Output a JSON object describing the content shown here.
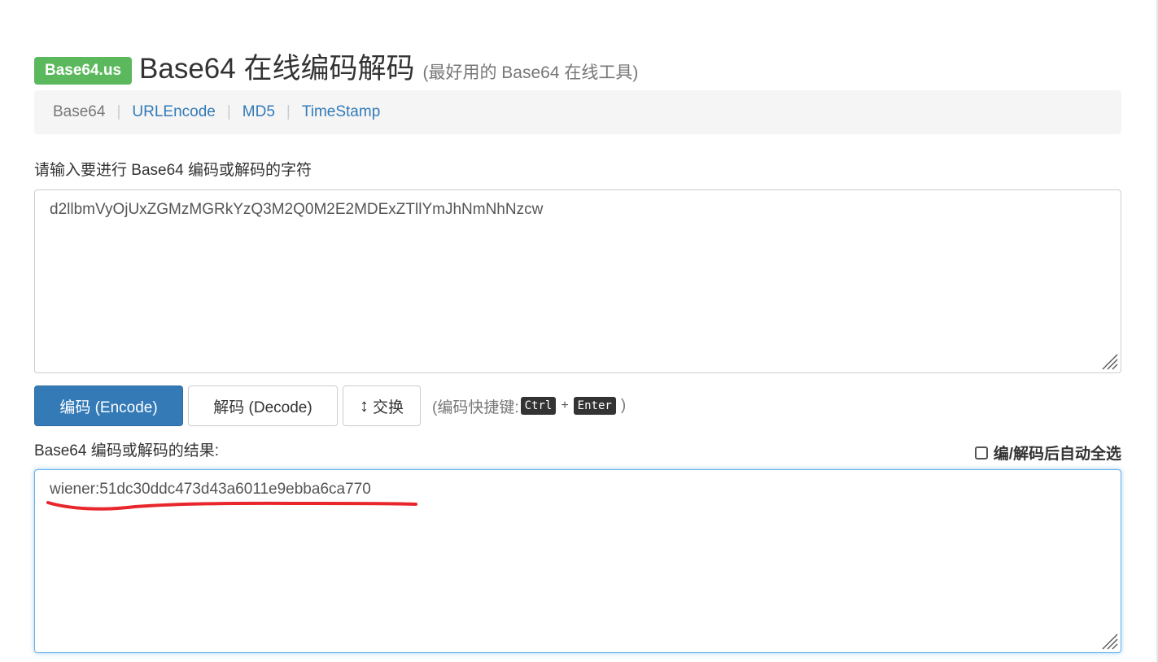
{
  "header": {
    "brand": "Base64.us",
    "title": "Base64 在线编码解码",
    "subtitle": "(最好用的 Base64 在线工具)"
  },
  "nav": {
    "items": [
      {
        "label": "Base64",
        "active": true
      },
      {
        "label": "URLEncode",
        "active": false
      },
      {
        "label": "MD5",
        "active": false
      },
      {
        "label": "TimeStamp",
        "active": false
      }
    ],
    "separator": "|"
  },
  "input": {
    "label": "请输入要进行 Base64 编码或解码的字符",
    "value": "d2llbmVyOjUxZGMzMGRkYzQ3M2Q0M2E2MDExZTllYmJhNmNhNzcw"
  },
  "actions": {
    "encode_label": "编码 (Encode)",
    "decode_label": "解码 (Decode)",
    "swap_label": "交换",
    "swap_icon": "up-down-arrow-icon",
    "shortcut_prefix": "(编码快捷键:",
    "shortcut_key1": "Ctrl",
    "shortcut_plus": "+",
    "shortcut_key2": "Enter",
    "shortcut_suffix": ")"
  },
  "output": {
    "label": "Base64 编码或解码的结果:",
    "auto_select_label": "编/解码后自动全选",
    "auto_select_checked": false,
    "value": "wiener:51dc30ddc473d43a6011e9ebba6ca770"
  },
  "colors": {
    "brand_green": "#5cb85c",
    "primary_blue": "#337ab7",
    "link_blue": "#337ab7",
    "annotation_red": "#e8262b"
  }
}
